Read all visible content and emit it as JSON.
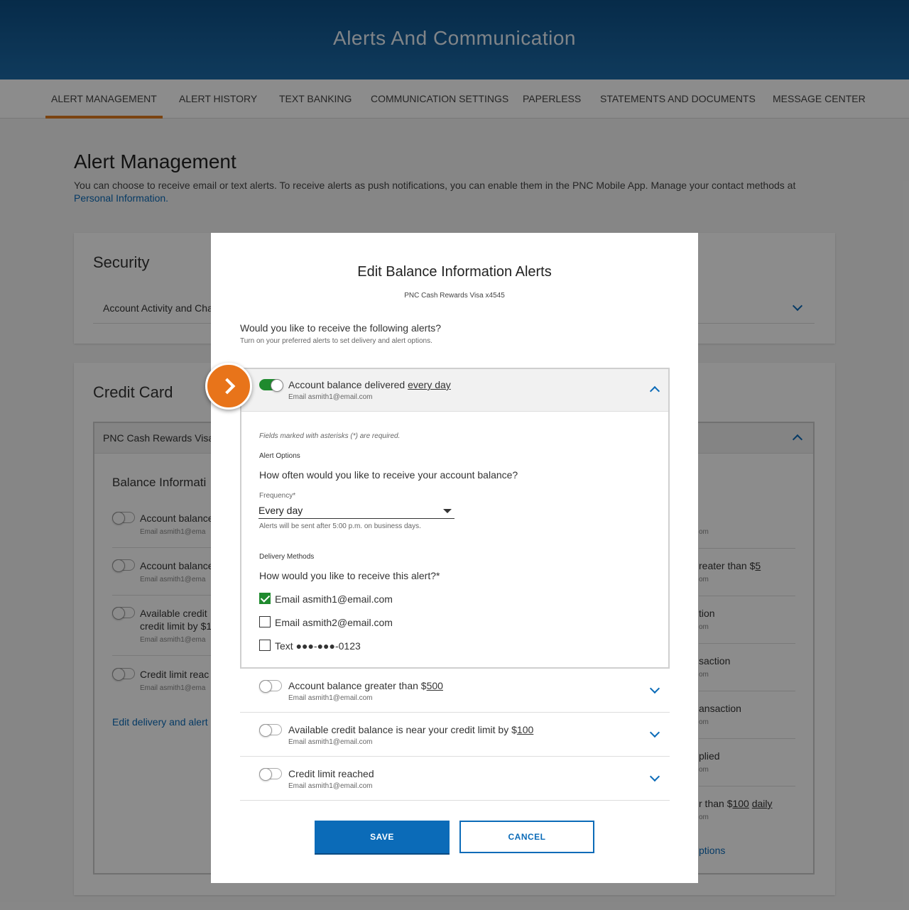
{
  "header": {
    "title": "Alerts And Communication"
  },
  "tabs": [
    "ALERT MANAGEMENT",
    "ALERT  HISTORY",
    "TEXT BANKING",
    "COMMUNICATION SETTINGS",
    "PAPERLESS",
    "STATEMENTS AND DOCUMENTS",
    "MESSAGE CENTER"
  ],
  "page": {
    "title": "Alert Management",
    "desc": "You can choose to receive email or text alerts. To receive alerts as push notifications, you can enable them in the PNC Mobile App. Manage your contact methods at ",
    "link": "Personal Information."
  },
  "security": {
    "title": "Security",
    "row": "Account Activity and Cha"
  },
  "credit": {
    "title": "Credit Card",
    "account": "PNC Cash Rewards Visa",
    "section": "Balance Informati",
    "left_rows": [
      {
        "label": "Account balance",
        "sub": "Email asmith1@ema"
      },
      {
        "label": "Account balance",
        "sub": "Email asmith1@ema"
      },
      {
        "label": "Available credit",
        "label2": "credit limit by $1",
        "sub": "Email asmith1@ema"
      },
      {
        "label": "Credit limit reac",
        "sub": "Email asmith1@ema"
      }
    ],
    "edit_link": "Edit delivery and alert",
    "right_rows": [
      {
        "label": "",
        "sub": "om"
      },
      {
        "label": "reater than $",
        "amount": "5",
        "sub": "om"
      },
      {
        "label": "tion",
        "sub": "om"
      },
      {
        "label": "saction",
        "sub": "om"
      },
      {
        "label": "ansaction",
        "sub": "om"
      },
      {
        "label": "plied",
        "sub": "om"
      },
      {
        "label": "r than $",
        "amount": "100",
        "suffix": "daily",
        "sub": "om"
      }
    ],
    "right_link": "ptions"
  },
  "modal": {
    "title": "Edit Balance Information Alerts",
    "subtitle": "PNC Cash Rewards Visa x4545",
    "question": "Would you like to receive the following alerts?",
    "hint": "Turn on your preferred alerts to set delivery and alert options.",
    "expanded": {
      "label": "Account balance delivered ",
      "label_link": "every day",
      "email": "Email asmith1@email.com",
      "required_note": "Fields marked with asterisks (*) are required.",
      "alert_options": "Alert Options",
      "freq_question": "How often would you like to receive your account balance?",
      "freq_label": "Frequency*",
      "freq_value": "Every day",
      "freq_note": "Alerts will be sent after 5:00 p.m. on business days.",
      "delivery_methods": "Delivery Methods",
      "delivery_question": "How would you like to receive this alert?*",
      "methods": [
        {
          "label": "Email asmith1@email.com",
          "checked": true
        },
        {
          "label": "Email asmith2@email.com",
          "checked": false
        },
        {
          "label": "Text ●●●-●●●-0123",
          "checked": false
        }
      ]
    },
    "rows": [
      {
        "label": "Account balance greater than $",
        "amount": "500",
        "email": "Email asmith1@email.com"
      },
      {
        "label": "Available credit balance is near your credit limit by $",
        "amount": "100",
        "email": "Email asmith1@email.com"
      },
      {
        "label": "Credit limit reached",
        "amount": "",
        "email": "Email asmith1@email.com"
      }
    ],
    "save": "SAVE",
    "cancel": "CANCEL"
  },
  "colors": {
    "brand_blue": "#0b6bb8",
    "accent_orange": "#e8741a",
    "toggle_on": "#1f8a2e"
  }
}
